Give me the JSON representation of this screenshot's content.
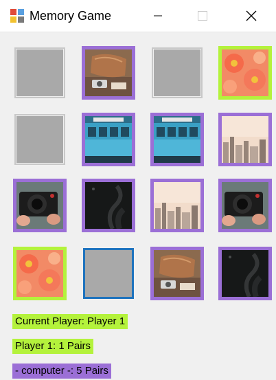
{
  "window": {
    "title": "Memory Game",
    "icon": "memory-game-app-icon",
    "controls": [
      "minimize-icon",
      "maximize-icon",
      "close-icon"
    ]
  },
  "colors": {
    "revealed_border": "#9b6fd6",
    "matched_border": "#b4f23c",
    "hidden_tile": "#a9a9a9",
    "selected_border": "#1e73be",
    "status_green": "#b4f23c",
    "status_purple": "#9b6fd6"
  },
  "board": {
    "rows": 4,
    "cols": 4,
    "cards": [
      {
        "state": "hidden",
        "image": ""
      },
      {
        "state": "revealed",
        "image": "desk-camera-leather-bag"
      },
      {
        "state": "hidden",
        "image": ""
      },
      {
        "state": "matched",
        "image": "orange-flowers"
      },
      {
        "state": "hidden",
        "image": ""
      },
      {
        "state": "revealed",
        "image": "blue-vintage-bus"
      },
      {
        "state": "revealed",
        "image": "blue-vintage-bus"
      },
      {
        "state": "revealed",
        "image": "city-skyline"
      },
      {
        "state": "revealed",
        "image": "hands-holding-camera"
      },
      {
        "state": "revealed",
        "image": "dark-smoke"
      },
      {
        "state": "revealed",
        "image": "city-skyline"
      },
      {
        "state": "revealed",
        "image": "hands-holding-camera"
      },
      {
        "state": "matched",
        "image": "orange-flowers"
      },
      {
        "state": "hidden-selected",
        "image": ""
      },
      {
        "state": "revealed",
        "image": "desk-camera-leather-bag"
      },
      {
        "state": "revealed",
        "image": "dark-smoke"
      }
    ]
  },
  "status": {
    "current_player": "Current Player: Player 1",
    "player1_score": "Player 1: 1 Pairs",
    "computer_score": "- computer -: 5 Pairs"
  }
}
